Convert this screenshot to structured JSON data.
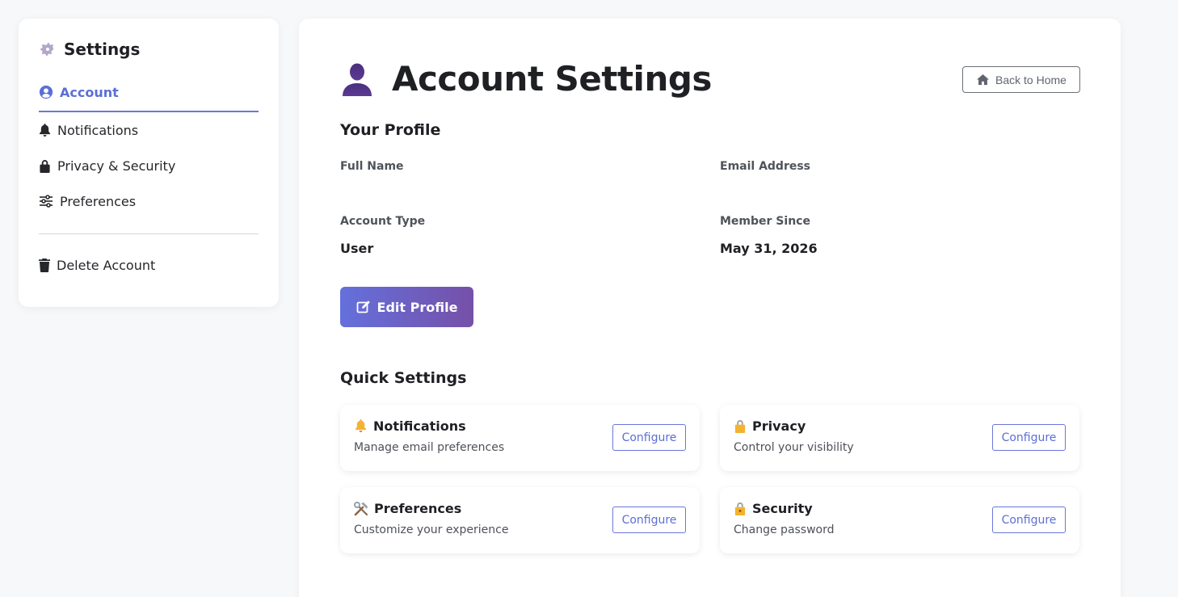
{
  "sidebar": {
    "title": "Settings",
    "title_icon": "gear-icon",
    "items": [
      {
        "label": "Account",
        "icon": "user-circle-icon",
        "active": true
      },
      {
        "label": "Notifications",
        "icon": "bell-icon"
      },
      {
        "label": "Privacy & Security",
        "icon": "lock-icon"
      },
      {
        "label": "Preferences",
        "icon": "sliders-icon"
      }
    ],
    "danger_item": {
      "label": "Delete Account",
      "icon": "trash-icon"
    }
  },
  "header": {
    "title": "Account Settings",
    "icon": "user-icon",
    "back_label": "Back to Home",
    "back_icon": "home-icon"
  },
  "profile": {
    "section_title": "Your Profile",
    "full_name_label": "Full Name",
    "full_name_value": "",
    "email_label": "Email Address",
    "email_value": "",
    "account_type_label": "Account Type",
    "account_type_value": "User",
    "member_since_label": "Member Since",
    "member_since_value": "May 31, 2026",
    "edit_label": "Edit Profile",
    "edit_icon": "edit-icon"
  },
  "quick_settings": {
    "section_title": "Quick Settings",
    "configure_label": "Configure",
    "cards": [
      {
        "title": "Notifications",
        "desc": "Manage email preferences",
        "icon": "bell-emoji-icon"
      },
      {
        "title": "Privacy",
        "desc": "Control your visibility",
        "icon": "lock-emoji-icon"
      },
      {
        "title": "Preferences",
        "desc": "Customize your experience",
        "icon": "tools-emoji-icon"
      },
      {
        "title": "Security",
        "desc": "Change password",
        "icon": "lock-key-emoji-icon"
      }
    ]
  },
  "colors": {
    "accent": "#5b6fd6",
    "gradient_start": "#6470dc",
    "gradient_end": "#7650a8",
    "background": "#f7f8fa"
  }
}
